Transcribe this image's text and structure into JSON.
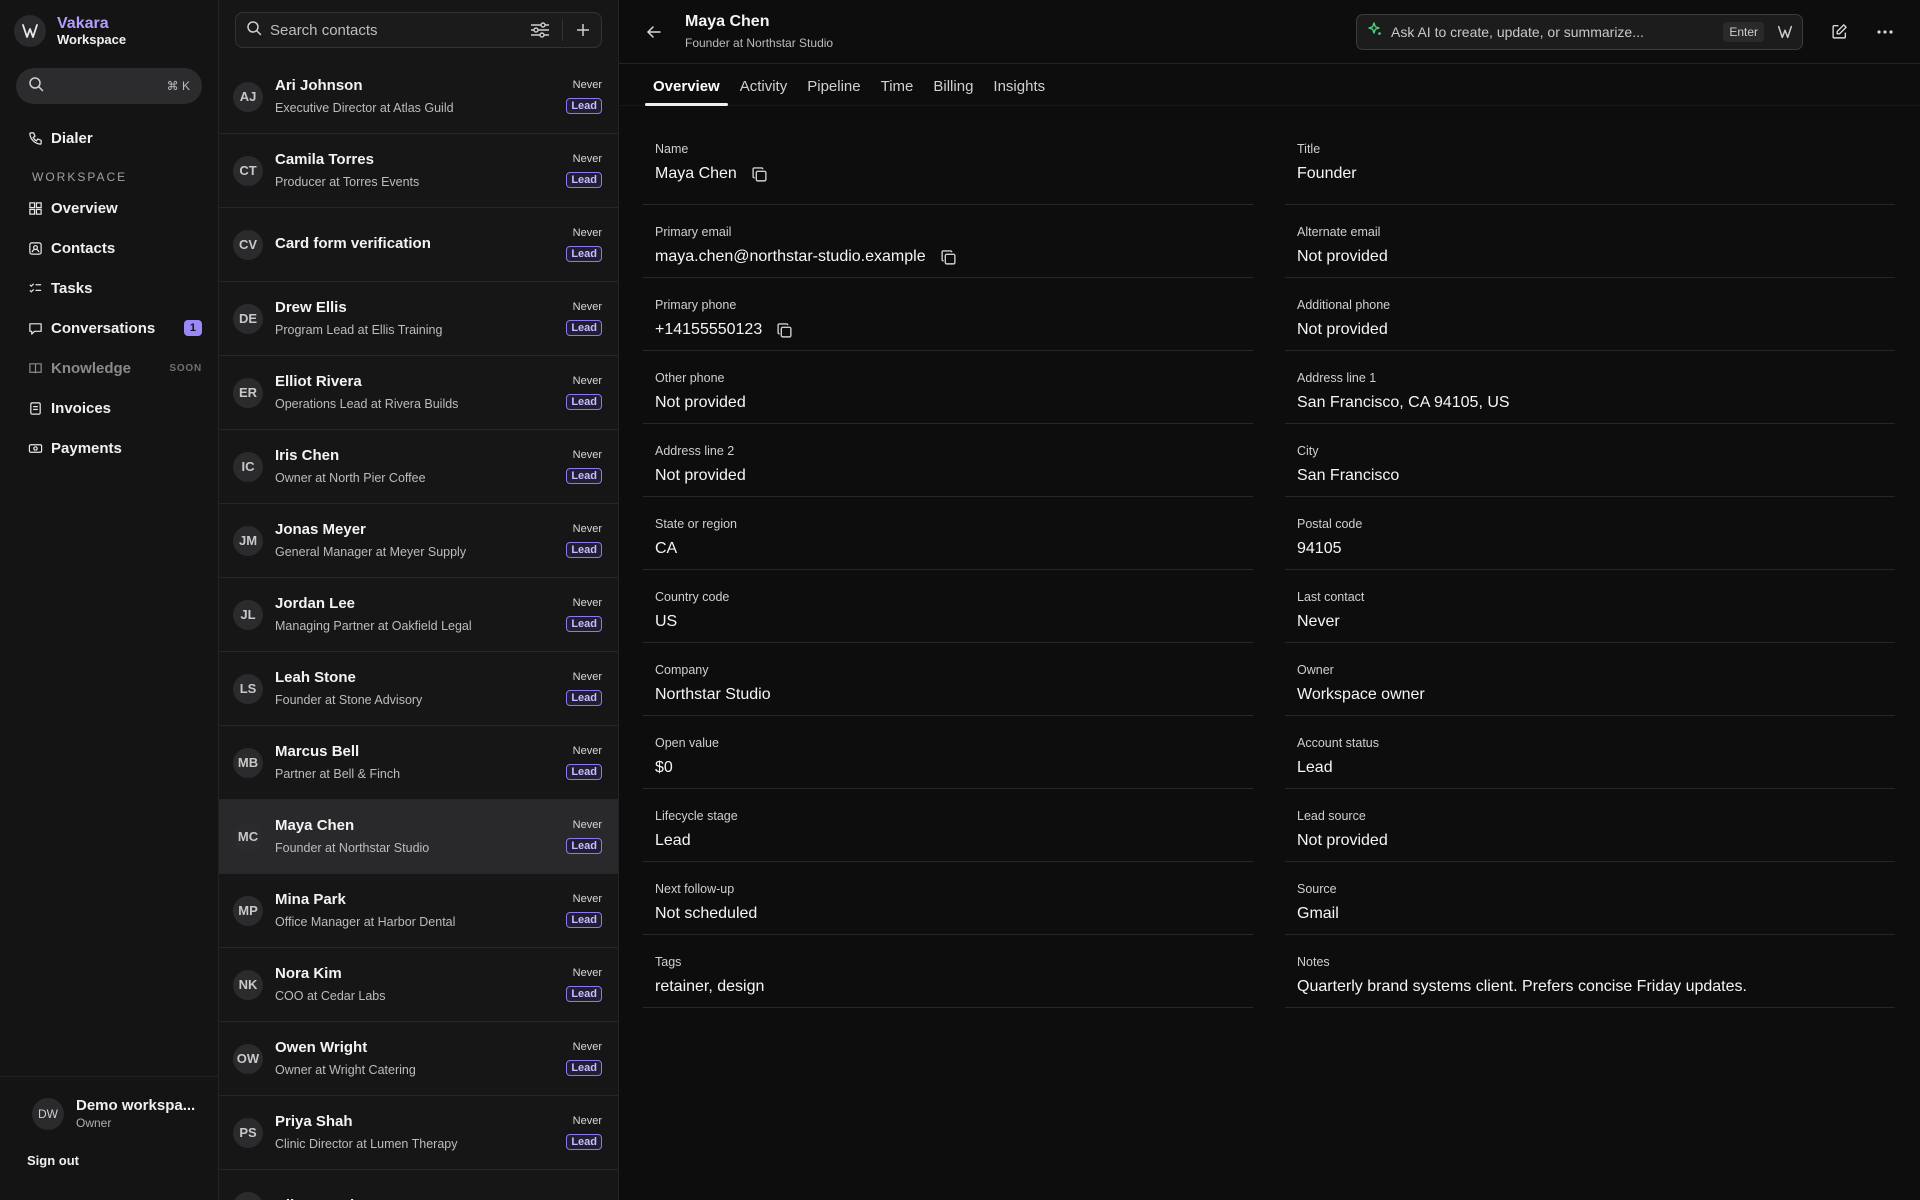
{
  "brand": {
    "name": "Vakara",
    "sub": "Workspace"
  },
  "sidebar": {
    "search_shortcut": "⌘ K",
    "dialer": "Dialer",
    "section_label": "WORKSPACE",
    "items": [
      {
        "label": "Overview",
        "icon": "grid-icon"
      },
      {
        "label": "Contacts",
        "icon": "contact-card-icon"
      },
      {
        "label": "Tasks",
        "icon": "checklist-icon"
      },
      {
        "label": "Conversations",
        "icon": "chat-icon",
        "badge": "1"
      },
      {
        "label": "Knowledge",
        "icon": "book-icon",
        "tag": "SOON"
      },
      {
        "label": "Invoices",
        "icon": "document-icon"
      },
      {
        "label": "Payments",
        "icon": "cash-icon"
      }
    ],
    "user": {
      "initials": "DW",
      "name": "Demo workspa...",
      "role": "Owner"
    },
    "sign_out": "Sign out"
  },
  "list": {
    "search_placeholder": "Search contacts",
    "contacts": [
      {
        "initials": "AJ",
        "name": "Ari Johnson",
        "sub": "Executive Director at Atlas Guild",
        "last": "Never",
        "status": "Lead"
      },
      {
        "initials": "CT",
        "name": "Camila Torres",
        "sub": "Producer at Torres Events",
        "last": "Never",
        "status": "Lead"
      },
      {
        "initials": "CV",
        "name": "Card form verification",
        "sub": "",
        "last": "Never",
        "status": "Lead"
      },
      {
        "initials": "DE",
        "name": "Drew Ellis",
        "sub": "Program Lead at Ellis Training",
        "last": "Never",
        "status": "Lead"
      },
      {
        "initials": "ER",
        "name": "Elliot Rivera",
        "sub": "Operations Lead at Rivera Builds",
        "last": "Never",
        "status": "Lead"
      },
      {
        "initials": "IC",
        "name": "Iris Chen",
        "sub": "Owner at North Pier Coffee",
        "last": "Never",
        "status": "Lead"
      },
      {
        "initials": "JM",
        "name": "Jonas Meyer",
        "sub": "General Manager at Meyer Supply",
        "last": "Never",
        "status": "Lead"
      },
      {
        "initials": "JL",
        "name": "Jordan Lee",
        "sub": "Managing Partner at Oakfield Legal",
        "last": "Never",
        "status": "Lead"
      },
      {
        "initials": "LS",
        "name": "Leah Stone",
        "sub": "Founder at Stone Advisory",
        "last": "Never",
        "status": "Lead"
      },
      {
        "initials": "MB",
        "name": "Marcus Bell",
        "sub": "Partner at Bell & Finch",
        "last": "Never",
        "status": "Lead"
      },
      {
        "initials": "MC",
        "name": "Maya Chen",
        "sub": "Founder at Northstar Studio",
        "last": "Never",
        "status": "Lead",
        "selected": true
      },
      {
        "initials": "MP",
        "name": "Mina Park",
        "sub": "Office Manager at Harbor Dental",
        "last": "Never",
        "status": "Lead"
      },
      {
        "initials": "NK",
        "name": "Nora Kim",
        "sub": "COO at Cedar Labs",
        "last": "Never",
        "status": "Lead"
      },
      {
        "initials": "OW",
        "name": "Owen Wright",
        "sub": "Owner at Wright Catering",
        "last": "Never",
        "status": "Lead"
      },
      {
        "initials": "PS",
        "name": "Priya Shah",
        "sub": "Clinic Director at Lumen Therapy",
        "last": "Never",
        "status": "Lead"
      },
      {
        "initials": "RB",
        "name": "Riley Brooks",
        "sub": "",
        "last": "Never",
        "status": ""
      }
    ]
  },
  "detail": {
    "name": "Maya Chen",
    "subtitle": "Founder at Northstar Studio",
    "ai_placeholder": "Ask AI to create, update, or summarize...",
    "ai_enter": "Enter",
    "tabs": [
      "Overview",
      "Activity",
      "Pipeline",
      "Time",
      "Billing",
      "Insights"
    ],
    "left_fields": [
      {
        "label": "Name",
        "value": "Maya Chen",
        "copy": true
      },
      {
        "label": "Primary email",
        "value": "maya.chen@northstar-studio.example",
        "copy": true
      },
      {
        "label": "Primary phone",
        "value": "+14155550123",
        "copy": true
      },
      {
        "label": "Other phone",
        "value": "Not provided"
      },
      {
        "label": "Address line 2",
        "value": "Not provided"
      },
      {
        "label": "State or region",
        "value": "CA"
      },
      {
        "label": "Country code",
        "value": "US"
      },
      {
        "label": "Company",
        "value": "Northstar Studio"
      },
      {
        "label": "Open value",
        "value": "$0"
      },
      {
        "label": "Lifecycle stage",
        "value": "Lead"
      },
      {
        "label": "Next follow-up",
        "value": "Not scheduled"
      },
      {
        "label": "Tags",
        "value": "retainer, design"
      }
    ],
    "right_fields": [
      {
        "label": "Title",
        "value": "Founder"
      },
      {
        "label": "Alternate email",
        "value": "Not provided"
      },
      {
        "label": "Additional phone",
        "value": "Not provided"
      },
      {
        "label": "Address line 1",
        "value": "San Francisco, CA 94105, US"
      },
      {
        "label": "City",
        "value": "San Francisco"
      },
      {
        "label": "Postal code",
        "value": "94105"
      },
      {
        "label": "Last contact",
        "value": "Never"
      },
      {
        "label": "Owner",
        "value": "Workspace owner"
      },
      {
        "label": "Account status",
        "value": "Lead"
      },
      {
        "label": "Lead source",
        "value": "Not provided"
      },
      {
        "label": "Source",
        "value": "Gmail"
      },
      {
        "label": "Notes",
        "value": "Quarterly brand systems client. Prefers concise Friday updates."
      }
    ]
  },
  "colors": {
    "accent": "#9b87f5",
    "background": "#0d0d0e"
  }
}
